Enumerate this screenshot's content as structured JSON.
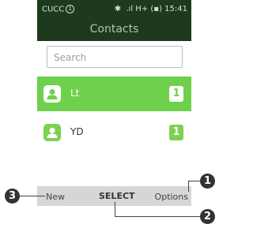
{
  "status_bar": {
    "carrier": "CUCC",
    "sim_slot": "1",
    "network": "H+",
    "time": "15:41"
  },
  "title": "Contacts",
  "search": {
    "placeholder": "Search",
    "value": ""
  },
  "contacts": [
    {
      "name": "Lt",
      "count": "1",
      "selected": true
    },
    {
      "name": "YD",
      "count": "1",
      "selected": false
    }
  ],
  "softkeys": {
    "left": "New",
    "center": "SELECT",
    "right": "Options"
  },
  "callouts": [
    "1",
    "2",
    "3"
  ],
  "colors": {
    "header": "#1e3a1e",
    "accent": "#6fd14b",
    "softkey_bar": "#d6d6d6",
    "callout": "#333333"
  }
}
